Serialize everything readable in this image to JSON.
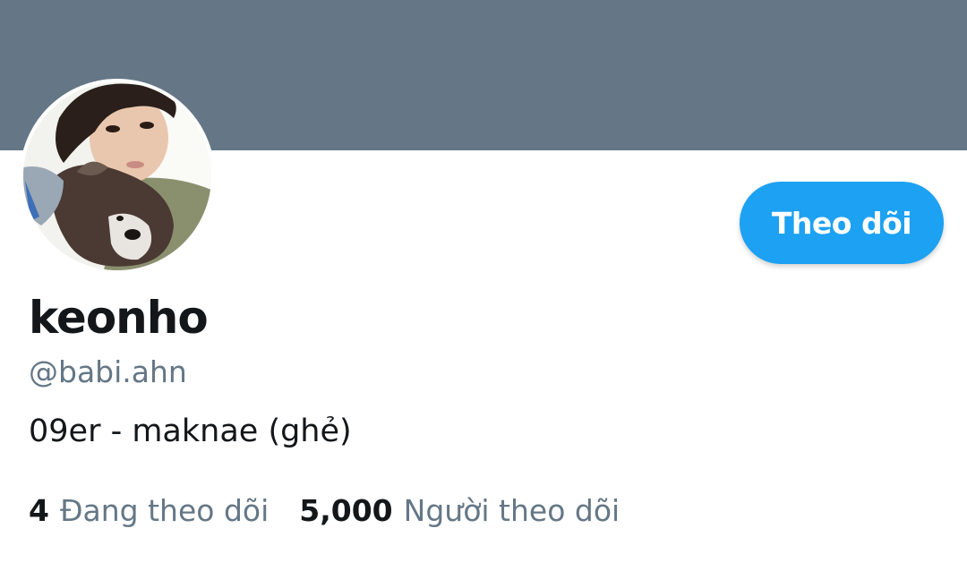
{
  "colors": {
    "banner": "#657786",
    "accent": "#1da1f2",
    "text_primary": "#14171a",
    "text_secondary": "#657786"
  },
  "profile": {
    "display_name": "keonho",
    "handle": "@babi.ahn",
    "bio": "09er - maknae (ghẻ)",
    "avatar_icon": "profile-photo"
  },
  "actions": {
    "follow_label": "Theo dõi"
  },
  "stats": {
    "following_count": "4",
    "following_label": "Đang theo dõi",
    "followers_count": "5,000",
    "followers_label": "Người theo dõi"
  }
}
